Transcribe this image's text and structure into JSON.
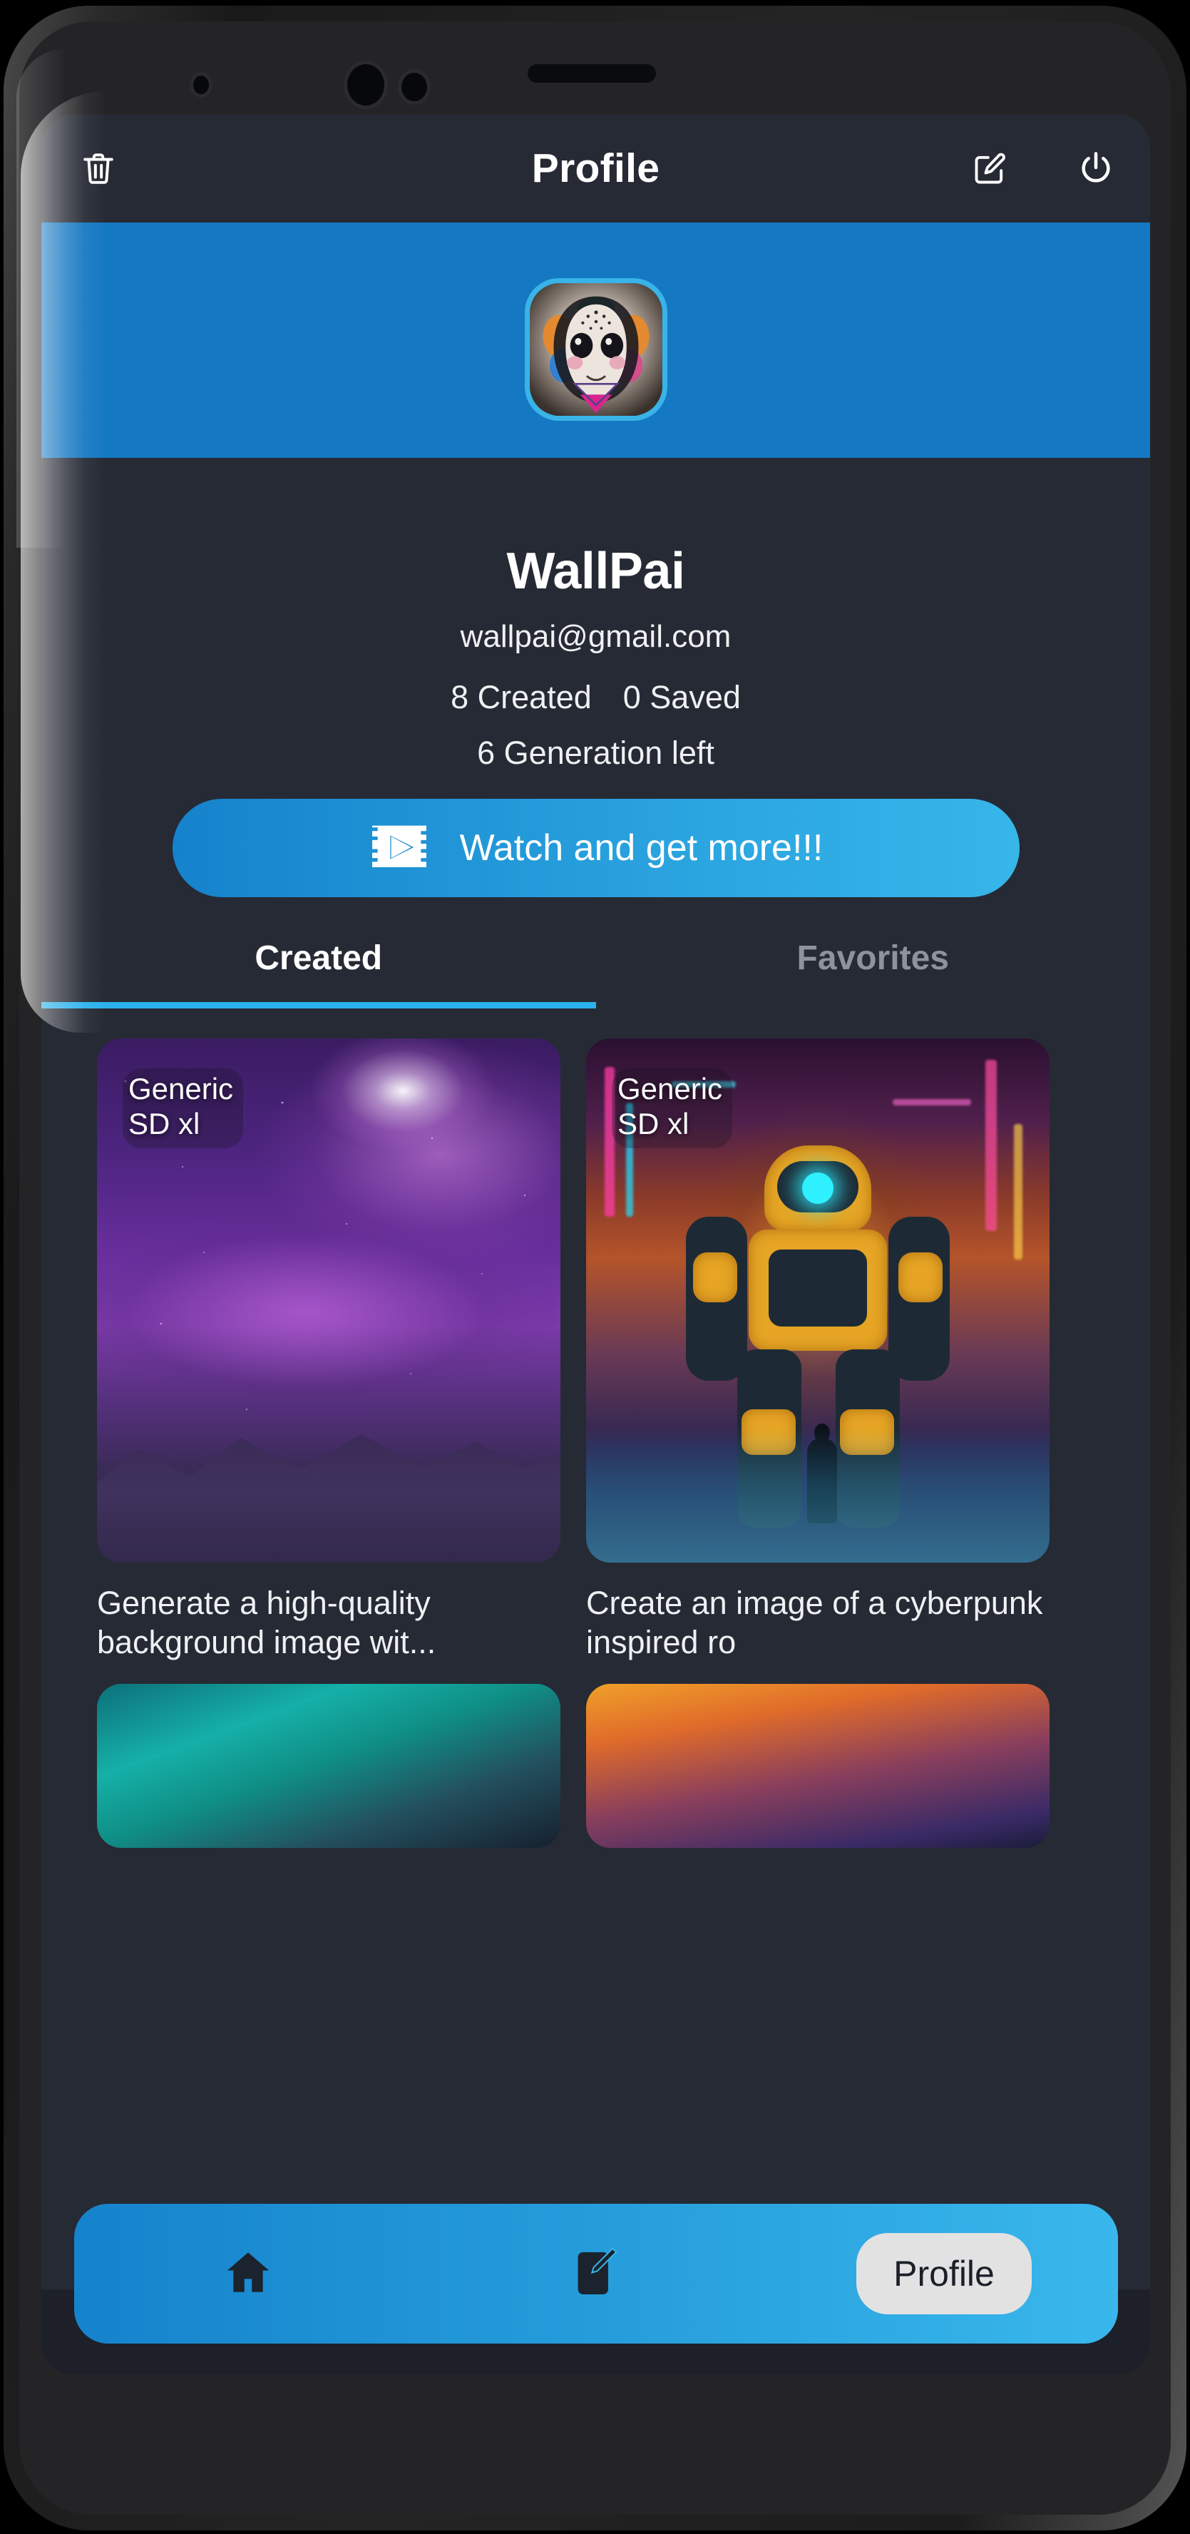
{
  "app": {
    "header": {
      "title": "Profile",
      "delete_icon": "trash-icon",
      "edit_icon": "edit-square-icon",
      "power_icon": "power-icon"
    },
    "profile": {
      "display_name": "WallPai",
      "email": "wallpai@gmail.com",
      "created_stat": "8 Created",
      "saved_stat": "0 Saved",
      "generations_left": "6 Generation left",
      "avatar_alt": "avatar"
    },
    "watch_button": {
      "label": "Watch and get more!!!",
      "icon": "video-ticket-icon"
    },
    "tabs": [
      {
        "label": "Created",
        "active": true
      },
      {
        "label": "Favorites",
        "active": false
      }
    ],
    "gallery": {
      "cards": [
        {
          "badge": "Generic\nSD xl",
          "badge_line1": "Generic",
          "badge_line2": "SD xl",
          "caption": "Generate a high-quality background image wit..."
        },
        {
          "badge_line1": "Generic",
          "badge_line2": "SD xl",
          "caption": "Create an image of a cyberpunk inspired ro"
        }
      ]
    },
    "bottom_nav": {
      "home_icon": "home-icon",
      "create_icon": "compose-icon",
      "profile_label": "Profile"
    },
    "colors": {
      "accent": "#2bb2ec",
      "banner": "#1578c2",
      "screen_bg": "#262a34",
      "nav_gradient_start": "#1583cc",
      "nav_gradient_end": "#39b7ec",
      "tab_inactive": "#8c939e"
    }
  }
}
